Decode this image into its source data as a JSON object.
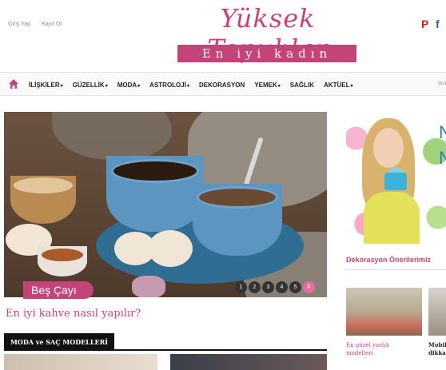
{
  "header": {
    "login": "Giriş Yap",
    "register": "Kayıt Ol",
    "logo_title": "Yüksek Topuklar",
    "logo_subtitle": "En iyi kadın sitesi",
    "social": [
      "P",
      "f"
    ]
  },
  "nav": {
    "home_icon": "home-icon",
    "items": [
      {
        "label": "İLİŞKİLER",
        "dropdown": true
      },
      {
        "label": "GÜZELLİK",
        "dropdown": true
      },
      {
        "label": "MODA",
        "dropdown": true
      },
      {
        "label": "ASTROLOJİ",
        "dropdown": true
      },
      {
        "label": "DEKORASYON",
        "dropdown": false
      },
      {
        "label": "YEMEK",
        "dropdown": true
      },
      {
        "label": "SAĞLIK",
        "dropdown": false
      },
      {
        "label": "AKTÜEL",
        "dropdown": true
      }
    ],
    "right_stub": "ara"
  },
  "slider": {
    "tag": "Beş Çayı",
    "pages": [
      "1",
      "2",
      "3",
      "4",
      "5",
      "6"
    ],
    "active_page": 6,
    "headline": "En iyi kahve nasıl yapılır?"
  },
  "section": {
    "title": "MODA ve SAÇ MODELLERİ"
  },
  "sidebar": {
    "ad_letters": [
      "N",
      "N"
    ],
    "heading": "Dekorasyon Önerilerimiz",
    "cards": [
      {
        "caption": "En güzel yastık modelleri"
      },
      {
        "caption": "Mobil dikka"
      }
    ]
  },
  "colors": {
    "brand": "#c4447a",
    "nav_text": "#222222",
    "section_bar": "#111111"
  }
}
